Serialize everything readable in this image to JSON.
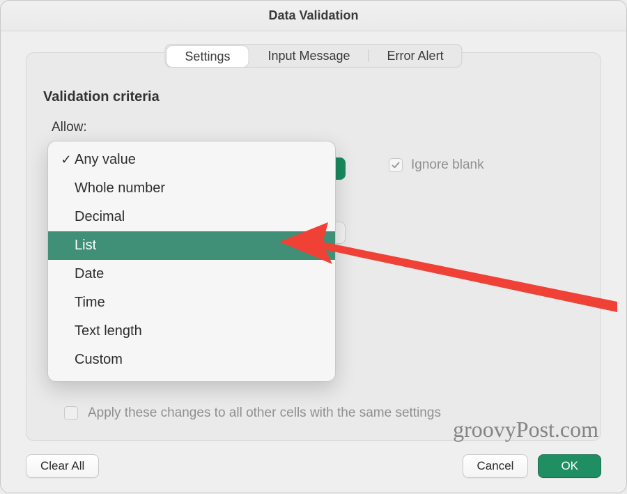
{
  "window": {
    "title": "Data Validation"
  },
  "tabs": {
    "settings": "Settings",
    "input_message": "Input Message",
    "error_alert": "Error Alert",
    "active": "settings"
  },
  "criteria": {
    "section_title": "Validation criteria",
    "allow_label": "Allow:",
    "ignore_blank_label": "Ignore blank",
    "ignore_blank_checked": true,
    "apply_label": "Apply these changes to all other cells with the same settings",
    "apply_checked": false
  },
  "dropdown": {
    "selected": "Any value",
    "highlighted": "List",
    "options": [
      "Any value",
      "Whole number",
      "Decimal",
      "List",
      "Date",
      "Time",
      "Text length",
      "Custom"
    ]
  },
  "buttons": {
    "clear_all": "Clear All",
    "cancel": "Cancel",
    "ok": "OK"
  },
  "watermark": "groovyPost.com",
  "colors": {
    "accent": "#1f8f63",
    "highlight": "#3f9077",
    "arrow": "#ef4136"
  }
}
